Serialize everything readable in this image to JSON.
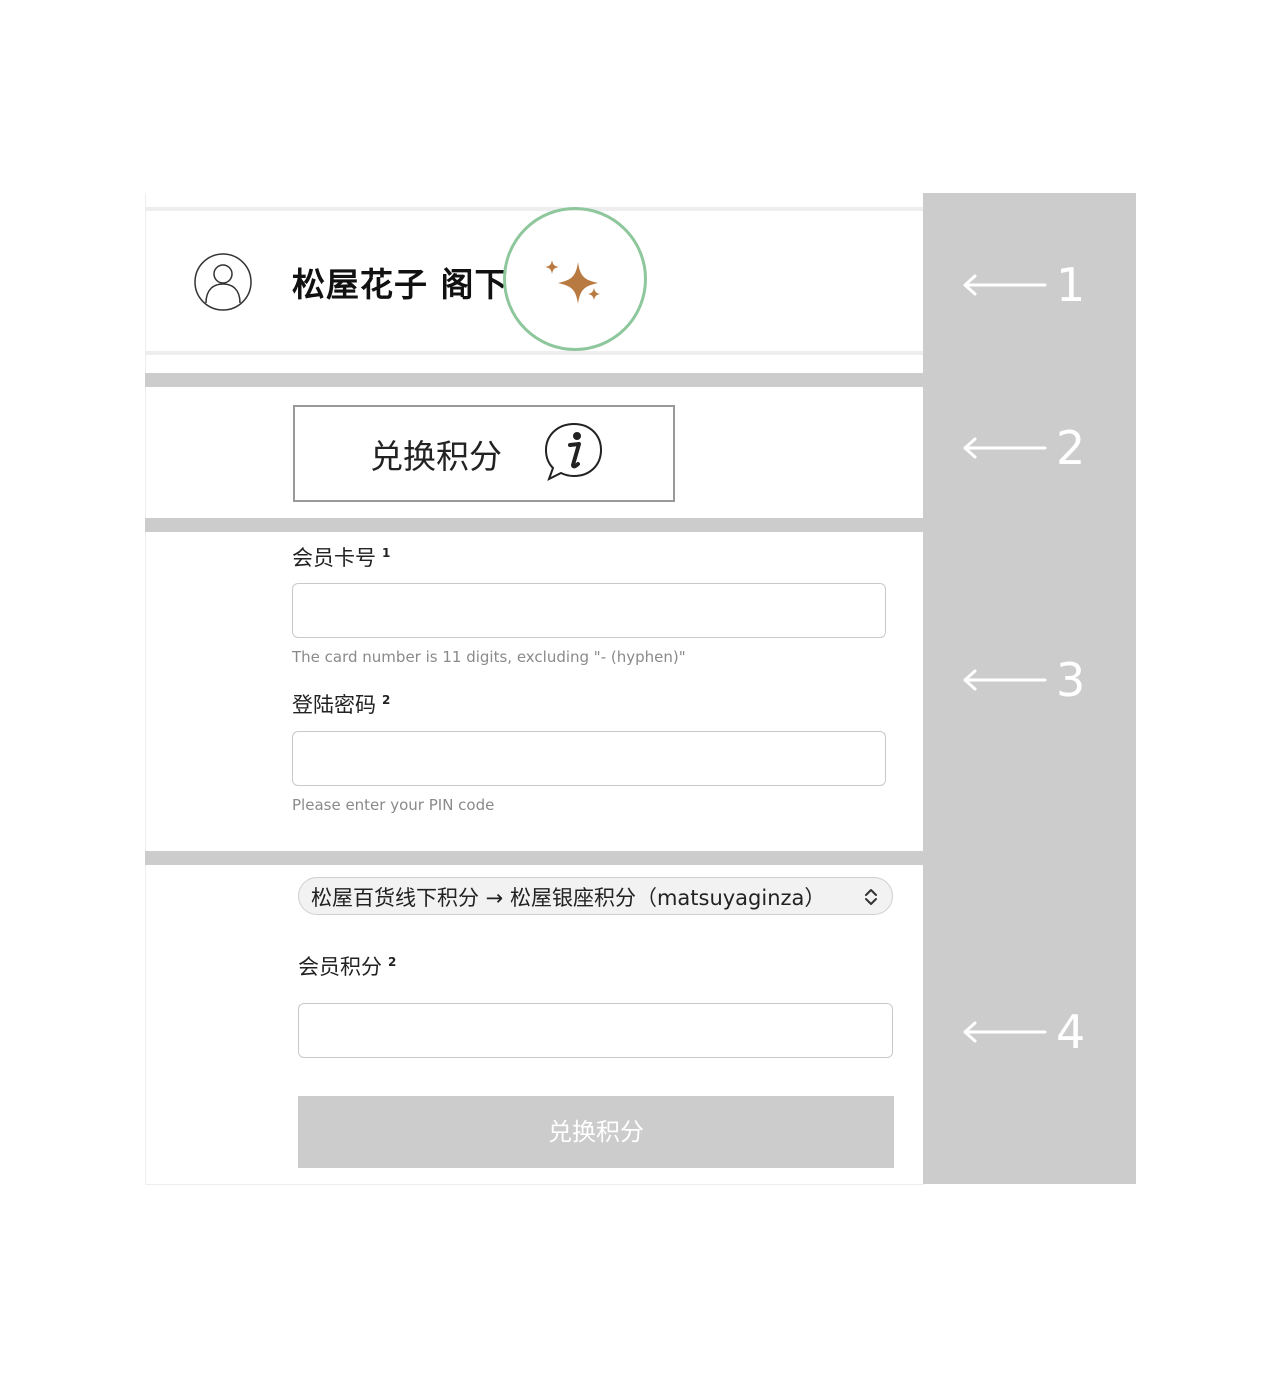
{
  "header": {
    "user_name": "松屋花子 阁下",
    "avatar_icon": "user-avatar-icon",
    "badge_icon": "sparkle-icon",
    "sparkle_color": "#b87a40",
    "highlight_color": "#8ec79c"
  },
  "exchange_info": {
    "label": "兑换积分",
    "icon": "info-speech-bubble-icon"
  },
  "card_number": {
    "label": "会员卡号",
    "footnote": "1",
    "value": "",
    "hint": "The card number is 11 digits, excluding \"- (hyphen)\""
  },
  "pin": {
    "label": "登陆密码",
    "footnote": "2",
    "value": "",
    "hint": "Please enter your PIN code"
  },
  "exchange_select": {
    "selected": "松屋百货线下积分 → 松屋银座积分（matsuyaginza）"
  },
  "points": {
    "label": "会员积分",
    "footnote": "2",
    "value": ""
  },
  "submit": {
    "label": "兑换积分"
  },
  "annotations": [
    {
      "number": "1"
    },
    {
      "number": "2"
    },
    {
      "number": "3"
    },
    {
      "number": "4"
    }
  ],
  "colors": {
    "annotation_bg": "#cccccc",
    "button_disabled": "#cccccc"
  }
}
